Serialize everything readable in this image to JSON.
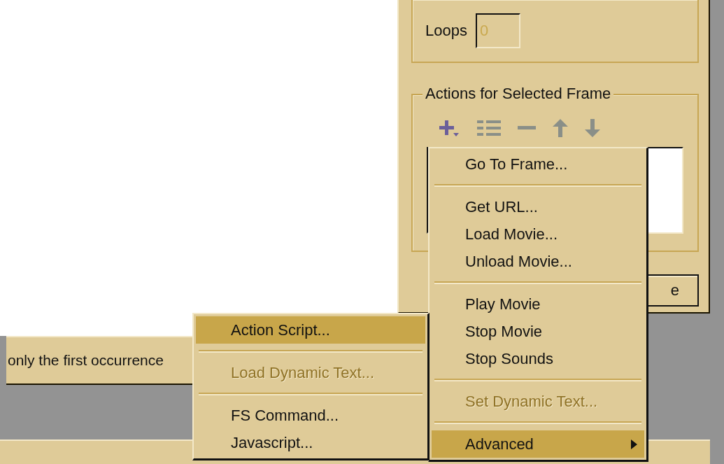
{
  "status_strip": {
    "text": "only the first occurrence"
  },
  "panel": {
    "loops": {
      "label": "Loops",
      "value": "0",
      "disabled": true
    },
    "actions_group": {
      "title": "Actions for Selected Frame"
    },
    "button": {
      "label": "e"
    }
  },
  "menu": {
    "items": [
      {
        "kind": "item",
        "label": "Go To Frame...",
        "selected": false,
        "disabled": false,
        "submenu": false
      },
      {
        "kind": "separator"
      },
      {
        "kind": "item",
        "label": "Get URL...",
        "selected": false,
        "disabled": false,
        "submenu": false
      },
      {
        "kind": "item",
        "label": "Load Movie...",
        "selected": false,
        "disabled": false,
        "submenu": false
      },
      {
        "kind": "item",
        "label": "Unload Movie...",
        "selected": false,
        "disabled": false,
        "submenu": false
      },
      {
        "kind": "separator"
      },
      {
        "kind": "item",
        "label": "Play Movie",
        "selected": false,
        "disabled": false,
        "submenu": false
      },
      {
        "kind": "item",
        "label": "Stop Movie",
        "selected": false,
        "disabled": false,
        "submenu": false
      },
      {
        "kind": "item",
        "label": "Stop Sounds",
        "selected": false,
        "disabled": false,
        "submenu": false
      },
      {
        "kind": "separator"
      },
      {
        "kind": "item",
        "label": "Set Dynamic Text...",
        "selected": false,
        "disabled": true,
        "submenu": false
      },
      {
        "kind": "separator"
      },
      {
        "kind": "item",
        "label": "Advanced",
        "selected": true,
        "disabled": false,
        "submenu": true
      }
    ]
  },
  "submenu": {
    "items": [
      {
        "kind": "item",
        "label": "Action Script...",
        "selected": true,
        "disabled": false,
        "submenu": false
      },
      {
        "kind": "separator"
      },
      {
        "kind": "item",
        "label": "Load Dynamic Text...",
        "selected": false,
        "disabled": true,
        "submenu": false
      },
      {
        "kind": "separator"
      },
      {
        "kind": "item",
        "label": "FS Command...",
        "selected": false,
        "disabled": false,
        "submenu": false
      },
      {
        "kind": "item",
        "label": "Javascript...",
        "selected": false,
        "disabled": false,
        "submenu": false
      }
    ]
  }
}
